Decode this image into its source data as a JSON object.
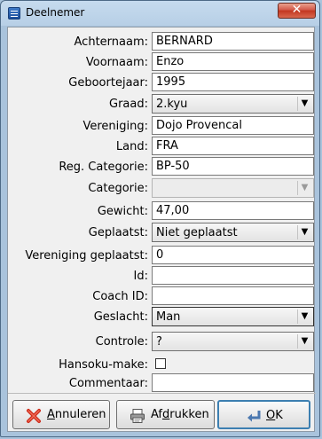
{
  "window": {
    "title": "Deelnemer",
    "close_label": "✕"
  },
  "form": {
    "achternaam": {
      "label": "Achternaam:",
      "value": "BERNARD"
    },
    "voornaam": {
      "label": "Voornaam:",
      "value": "Enzo"
    },
    "geboortejaar": {
      "label": "Geboortejaar:",
      "value": "1995"
    },
    "graad": {
      "label": "Graad:",
      "value": "2.kyu"
    },
    "vereniging": {
      "label": "Vereniging:",
      "value": "Dojo Provencal"
    },
    "land": {
      "label": "Land:",
      "value": "FRA"
    },
    "reg_categorie": {
      "label": "Reg. Categorie:",
      "value": "BP-50"
    },
    "categorie": {
      "label": "Categorie:",
      "value": ""
    },
    "gewicht": {
      "label": "Gewicht:",
      "value": "47,00"
    },
    "geplaatst": {
      "label": "Geplaatst:",
      "value": "Niet geplaatst"
    },
    "vereniging_geplaatst": {
      "label": "Vereniging geplaatst:",
      "value": "0"
    },
    "id": {
      "label": "Id:",
      "value": ""
    },
    "coach_id": {
      "label": "Coach ID:",
      "value": ""
    },
    "geslacht": {
      "label": "Geslacht:",
      "value": "Man"
    },
    "controle": {
      "label": "Controle:",
      "value": "?"
    },
    "hansoku_make": {
      "label": "Hansoku-make:",
      "checked": false
    },
    "commentaar": {
      "label": "Commentaar:",
      "value": ""
    }
  },
  "buttons": {
    "annuleren": {
      "pre": "",
      "mnemonic": "A",
      "post": "nnuleren",
      "icon": "cancel-x-icon"
    },
    "afdrukken": {
      "pre": "Af",
      "mnemonic": "d",
      "post": "rukken",
      "icon": "printer-icon"
    },
    "ok": {
      "pre": "",
      "mnemonic": "O",
      "post": "K",
      "icon": "enter-arrow-icon"
    }
  },
  "colors": {
    "accent": "#3c7fb1",
    "cancel_red": "#cc2a1a",
    "titlebar": "#b7cfe6"
  }
}
